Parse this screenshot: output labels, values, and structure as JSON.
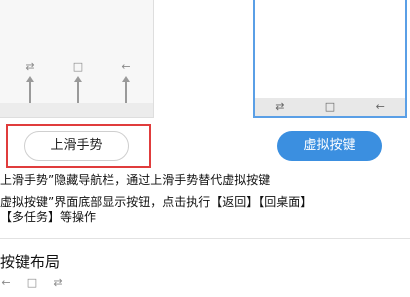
{
  "preview_gesture": {
    "glyphs": [
      "⇄",
      "□",
      "←"
    ]
  },
  "preview_virtual": {
    "nav_glyphs": [
      "⇄",
      "□",
      "←"
    ]
  },
  "buttons": {
    "gesture_label": "上滑手势",
    "virtual_label": "虚拟按键"
  },
  "description": {
    "line1": "上滑手势”隐藏导航栏，通过上滑手势替代虚拟按键",
    "line2": "虚拟按键”界面底部显示按钮，点击执行【返回】【回桌面】",
    "line3": "【多任务】等操作"
  },
  "layout_section": {
    "title": "按键布局",
    "icons": [
      "←",
      "□",
      "⇄"
    ]
  },
  "colors": {
    "accent": "#3b8fe0",
    "highlight": "#e03c3c"
  }
}
